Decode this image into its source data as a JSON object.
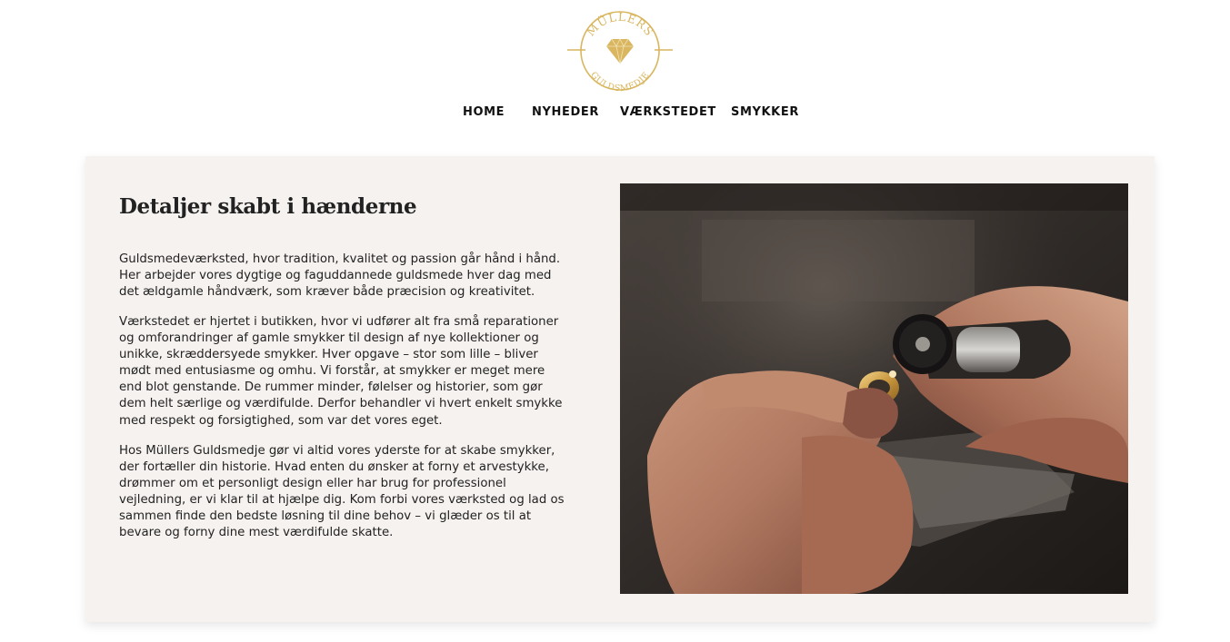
{
  "brand": {
    "logo_top": "MÜLLERS",
    "logo_bottom": "GULDSMEDJE",
    "gold_color": "#d9b65f"
  },
  "nav": {
    "items": [
      {
        "label": "HOME"
      },
      {
        "label": "NYHEDER"
      },
      {
        "label": "VÆRKSTEDET"
      },
      {
        "label": "SMYKKER"
      }
    ]
  },
  "main": {
    "title": "Detaljer skabt i hænderne",
    "paragraphs": [
      "Guldsmedeværksted, hvor tradition, kvalitet og passion går hånd i hånd. Her arbejder vores dygtige og faguddannede guldsmede hver dag med det ældgamle håndværk, som kræver både præcision og kreativitet.",
      "Værkstedet er hjertet i butikken, hvor vi udfører alt fra små reparationer og omforandringer af gamle smykker til design af nye kollektioner og unikke, skræddersyede smykker. Hver opgave – stor som lille – bliver mødt med entusiasme og omhu. Vi forstår, at smykker er meget mere end blot genstande. De rummer minder, følelser og historier, som gør dem helt særlige og værdifulde. Derfor behandler vi hvert enkelt smykke med respekt og forsigtighed, som var det vores eget.",
      "Hos Müllers Guldsmedje gør vi altid vores yderste for at skabe smykker, der fortæller din historie. Hvad enten du ønsker at forny et arvestykke, drømmer om et personligt design eller har brug for professionel vejledning, er vi klar til at hjælpe dig. Kom forbi vores værksted og lad os sammen finde den bedste løsning til dine behov – vi glæder os til at bevare og forny dine mest værdifulde skatte."
    ],
    "card_background": "#f6f2ef"
  }
}
